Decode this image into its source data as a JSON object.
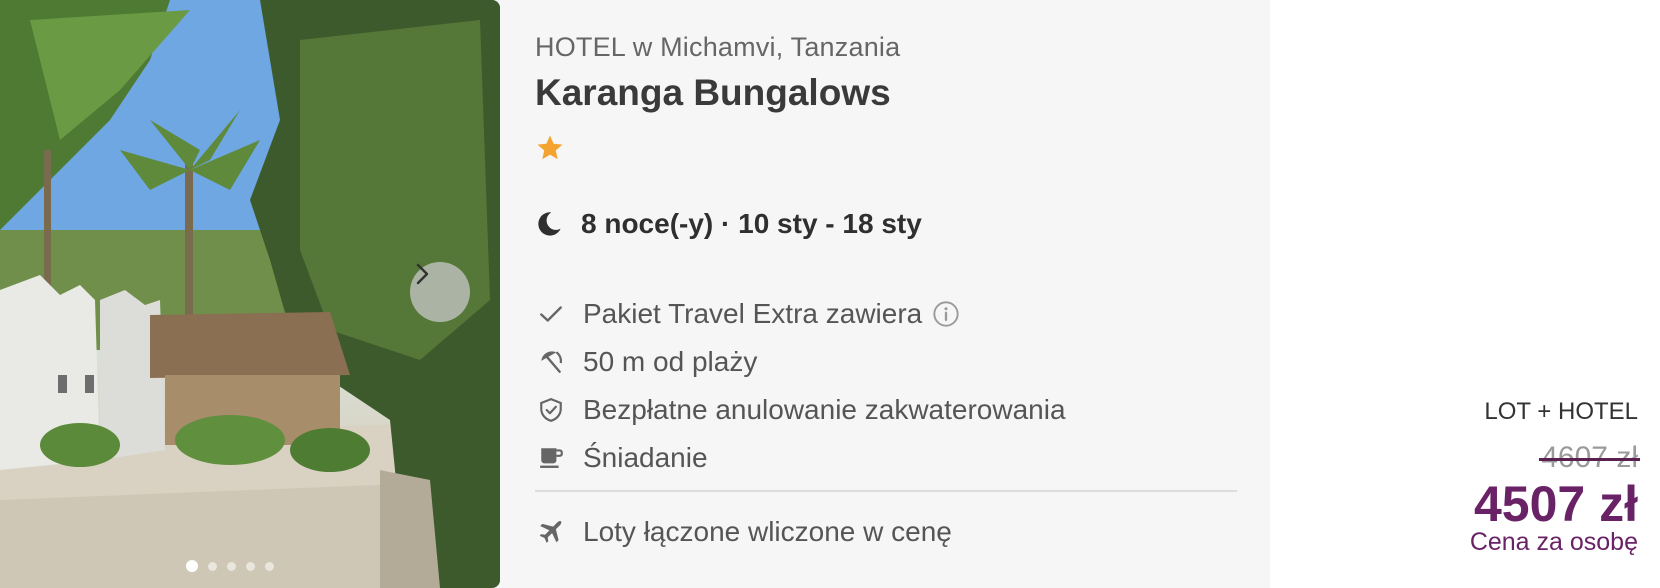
{
  "gallery": {
    "dot_count": 5,
    "active_index": 0
  },
  "hotel": {
    "location": "HOTEL w Michamvi, Tanzania",
    "name": "Karanga Bungalows",
    "stars": 1,
    "star_color": "#f5a330"
  },
  "stay": {
    "icon": "moon-icon",
    "text": "8 noce(-y) · 10 sty - 18 sty"
  },
  "features": [
    {
      "icon": "check-icon",
      "text": "Pakiet Travel Extra zawiera",
      "has_info": true
    },
    {
      "icon": "beach-umbrella-icon",
      "text": "50 m od plaży",
      "has_info": false
    },
    {
      "icon": "shield-check-icon",
      "text": "Bezpłatne anulowanie zakwaterowania",
      "has_info": false
    },
    {
      "icon": "coffee-cup-icon",
      "text": "Śniadanie",
      "has_info": false
    }
  ],
  "flights": {
    "icon": "airplane-icon",
    "text": "Loty łączone wliczone w cenę"
  },
  "price": {
    "type": "LOT + HOTEL",
    "old": "4607 zł",
    "new": "4507 zł",
    "per_person": "Cena za osobę",
    "accent_color": "#6a2266"
  }
}
